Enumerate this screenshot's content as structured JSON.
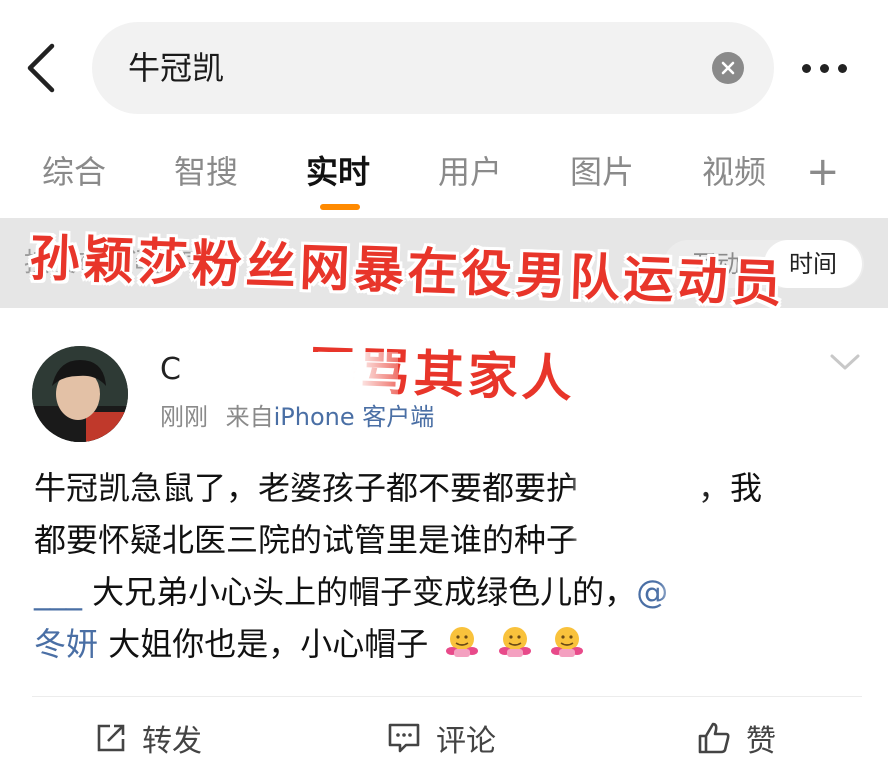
{
  "header": {
    "search_value": "牛冠凯",
    "back_icon": "chevron-left-icon",
    "clear_icon": "clear-icon",
    "more_icon": "more-icon"
  },
  "tabs": [
    {
      "label": "综合",
      "active": false
    },
    {
      "label": "智搜",
      "active": false
    },
    {
      "label": "实时",
      "active": true
    },
    {
      "label": "用户",
      "active": false
    },
    {
      "label": "图片",
      "active": false
    },
    {
      "label": "视频",
      "active": false
    }
  ],
  "tab_plus": "+",
  "filter": {
    "label": "按发布时间排序",
    "options": [
      {
        "label": "互动",
        "active": false
      },
      {
        "label": "时间",
        "active": true
      }
    ]
  },
  "overlay": {
    "line1": "孙颖莎粉丝网暴在役男队运动员",
    "line2": "辱骂其家人",
    "color": "#e8352a"
  },
  "post": {
    "username": "C",
    "time": "刚刚",
    "source_prefix": "来自",
    "source": "iPhone 客户端",
    "content": {
      "line1_a": "牛冠凯急鼠了，老婆孩子都不要都要护",
      "line1_b": "，我",
      "line2": "都要怀疑北医三院的试管里是谁的种子",
      "line3_a": "___",
      "line3_b": " 大兄弟小心头上的帽子变成绿色儿的，",
      "line3_mention": "@",
      "line4_mention": "冬妍",
      "line4": " 大姐你也是，小心帽子"
    },
    "emoji": "hugging-face-emoji"
  },
  "actions": {
    "repost": "转发",
    "comment": "评论",
    "like": "赞"
  },
  "colors": {
    "accent": "#ff8a00",
    "link": "#4a6fa5"
  }
}
